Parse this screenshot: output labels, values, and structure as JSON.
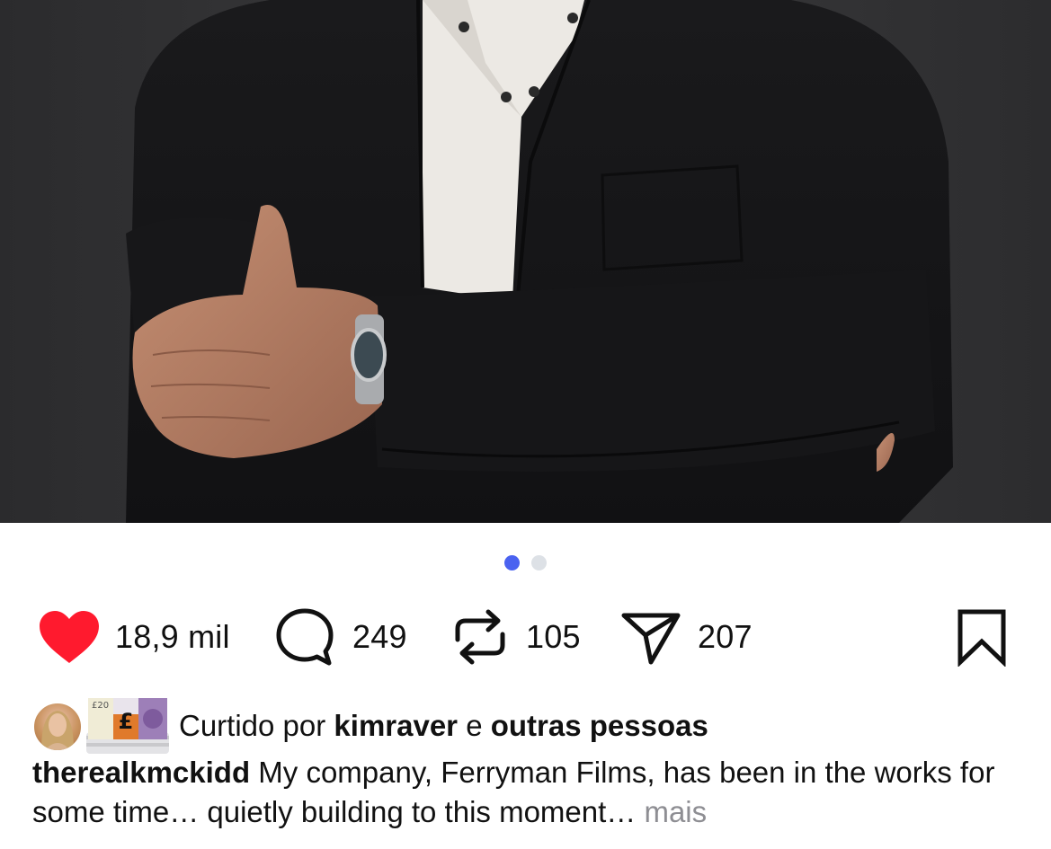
{
  "post": {
    "image_alt": "Man in black blazer and white polo with arms crossed",
    "carousel": {
      "total": 2,
      "active_index": 0
    }
  },
  "actions": {
    "like": {
      "icon": "heart-filled-icon",
      "count": "18,9 mil",
      "color": "#ff1a2e"
    },
    "comment": {
      "icon": "comment-bubble-icon",
      "count": "249"
    },
    "repost": {
      "icon": "repost-icon",
      "count": "105"
    },
    "share": {
      "icon": "send-icon",
      "count": "207"
    },
    "save": {
      "icon": "bookmark-icon"
    }
  },
  "likes": {
    "prefix": "Curtido por",
    "user": "kimraver",
    "connector": "e",
    "others": "outras pessoas",
    "money_emoji_label": "£20"
  },
  "caption": {
    "username": "therealkmckidd",
    "text": "My company, Ferryman Films, has been in the works for some time… quietly building to this moment…",
    "more_label": "mais"
  },
  "colors": {
    "accent_dot": "#4a62f0",
    "inactive_dot": "#dde1e6",
    "muted_text": "#8e8e93"
  }
}
